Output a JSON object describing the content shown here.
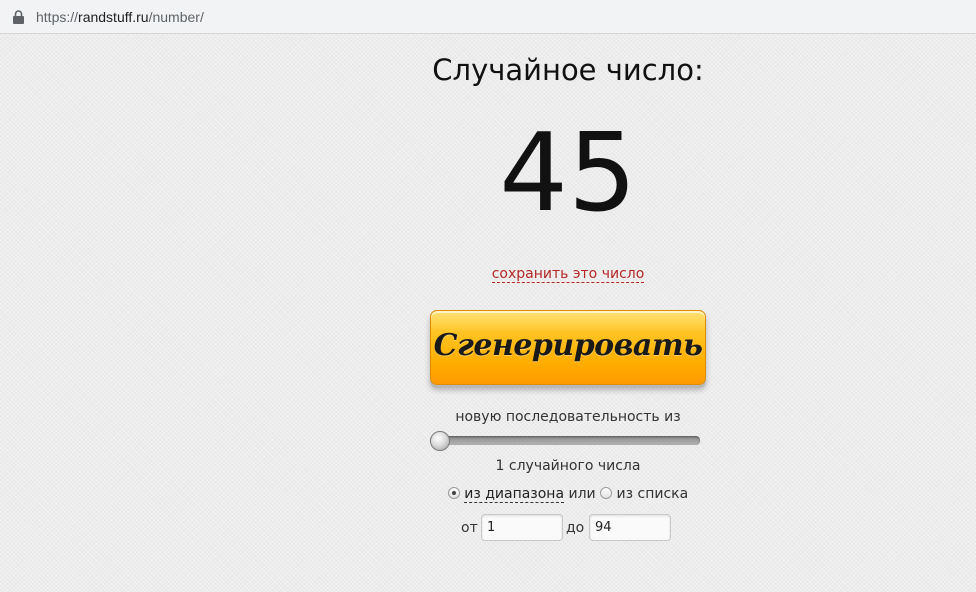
{
  "browser": {
    "url_scheme": "https://",
    "url_host": "randstuff.ru",
    "url_path": "/number/",
    "lock_icon": "lock-icon"
  },
  "main": {
    "heading": "Случайное число:",
    "number": "45",
    "save_link": "сохранить это число",
    "generate_button": "Сгенерировать",
    "sequence_label": "новую последовательность из",
    "slider_value": 1,
    "slider_min": 1,
    "slider_max": 100,
    "count_label": "1 случайного числа",
    "mode": {
      "range_option": "из диапазона",
      "or_text": " или ",
      "list_option": "из списка",
      "selected": "range"
    },
    "range": {
      "from_label": "от",
      "from_value": "1",
      "to_label": "до",
      "to_value": "94"
    }
  },
  "colors": {
    "link_red": "#b42828",
    "button_orange": "#ffae00",
    "background": "#ececec"
  }
}
